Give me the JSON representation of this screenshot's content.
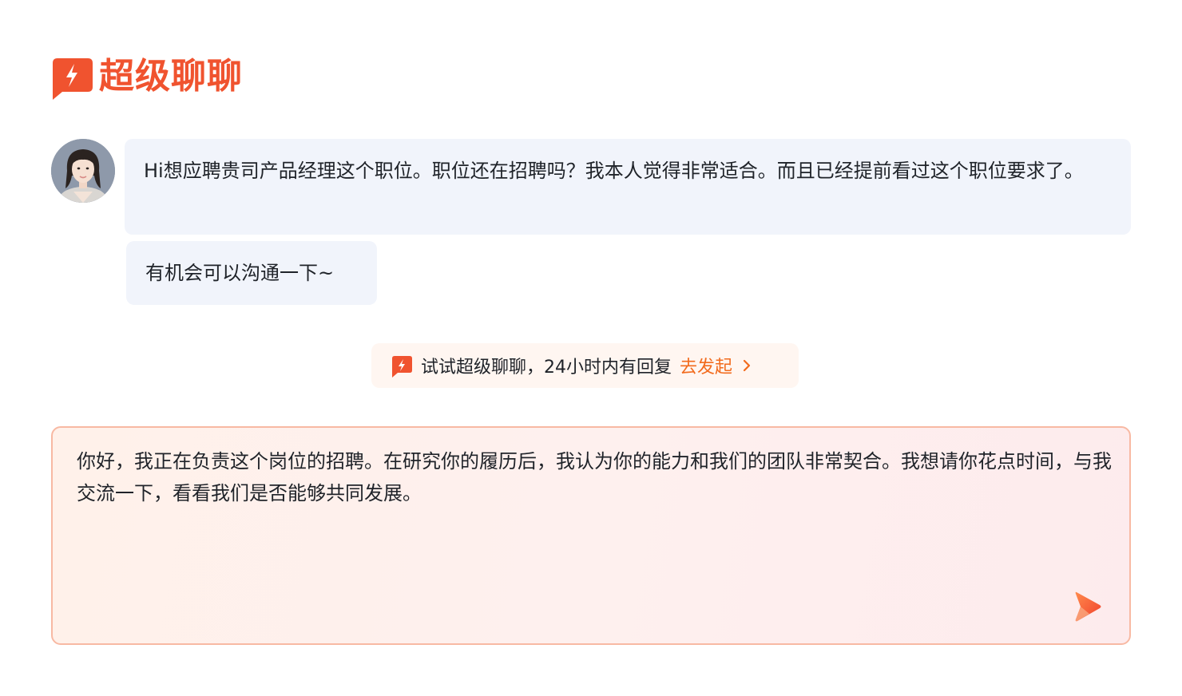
{
  "brand": {
    "title": "超级聊聊",
    "icon": "lightning-chat-icon",
    "color": "#f0532f"
  },
  "conversation": {
    "avatar": "candidate-avatar",
    "messages": [
      {
        "text": "Hi想应聘贵司产品经理这个职位。职位还在招聘吗？我本人觉得非常适合。而且已经提前看过这个职位要求了。"
      },
      {
        "text": "有机会可以沟通一下~"
      }
    ]
  },
  "promo": {
    "icon": "lightning-chat-icon",
    "text": "试试超级聊聊，24小时内有回复",
    "action_label": "去发起",
    "action_icon": "chevron-right-icon",
    "action_color": "#f26b1d"
  },
  "composer": {
    "value": "你好，我正在负责这个岗位的招聘。在研究你的履历后，我认为你的能力和我们的团队非常契合。我想请你花点时间，与我交流一下，看看我们是否能够共同发展。",
    "send_icon": "send-icon"
  }
}
